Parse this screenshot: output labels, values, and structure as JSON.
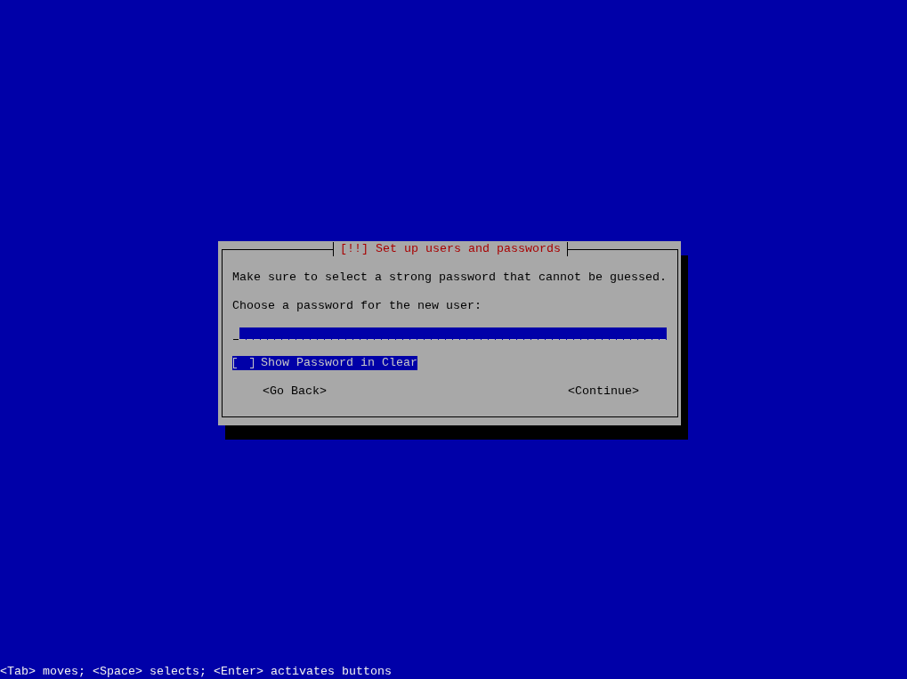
{
  "dialog": {
    "title": "[!!] Set up users and passwords",
    "message": "Make sure to select a strong password that cannot be guessed.",
    "prompt": "Choose a password for the new user:",
    "show_password": {
      "label": "Show Password in Clear",
      "checked": false,
      "focused": true
    },
    "buttons": [
      {
        "label": "<Go Back>",
        "focused": false
      },
      {
        "label": "<Continue>",
        "focused": false
      }
    ]
  },
  "help_line": "<Tab> moves; <Space> selects; <Enter> activates buttons"
}
